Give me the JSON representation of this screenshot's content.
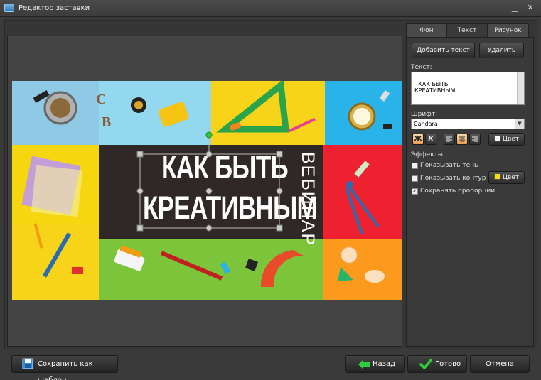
{
  "window": {
    "title": "Редактор заставки",
    "minimize_icon": "minimize-icon",
    "close_icon": "close-icon"
  },
  "tabs": [
    {
      "label": "Фон",
      "active": false
    },
    {
      "label": "Текст",
      "active": true
    },
    {
      "label": "Рисунок",
      "active": false
    }
  ],
  "side": {
    "add_text": "Добавить текст",
    "delete": "Удалить",
    "text_label": "Текст:",
    "text_value": "КАК БЫТЬ\nКРЕАТИВНЫМ",
    "font_label": "Шрифт:",
    "font_value": "Candara",
    "bold": "Ж",
    "italic": "К",
    "color_button": "Цвет",
    "text_color": "#ffffff",
    "effects_label": "Эффекты:",
    "shadow_label": "Показывать тень",
    "shadow_checked": false,
    "outline_label": "Показывать контур",
    "outline_checked": false,
    "outline_color_button": "Цвет",
    "outline_color": "#f5e000",
    "proportions_label": "Сохранять пропорции",
    "proportions_checked": true,
    "checked_mark": "✓"
  },
  "canvas": {
    "line1": "КАК БЫТЬ",
    "line2": "КРЕАТИВНЫМ",
    "vertical": "ВЕБИНАР",
    "letters": [
      "C",
      "B"
    ]
  },
  "bottom": {
    "save_template": "Сохранить как шаблон",
    "back": "Назад",
    "done": "Готово",
    "cancel": "Отмена"
  },
  "colors": {
    "accent_green": "#2ecc40",
    "active_format": "#f0b060"
  }
}
